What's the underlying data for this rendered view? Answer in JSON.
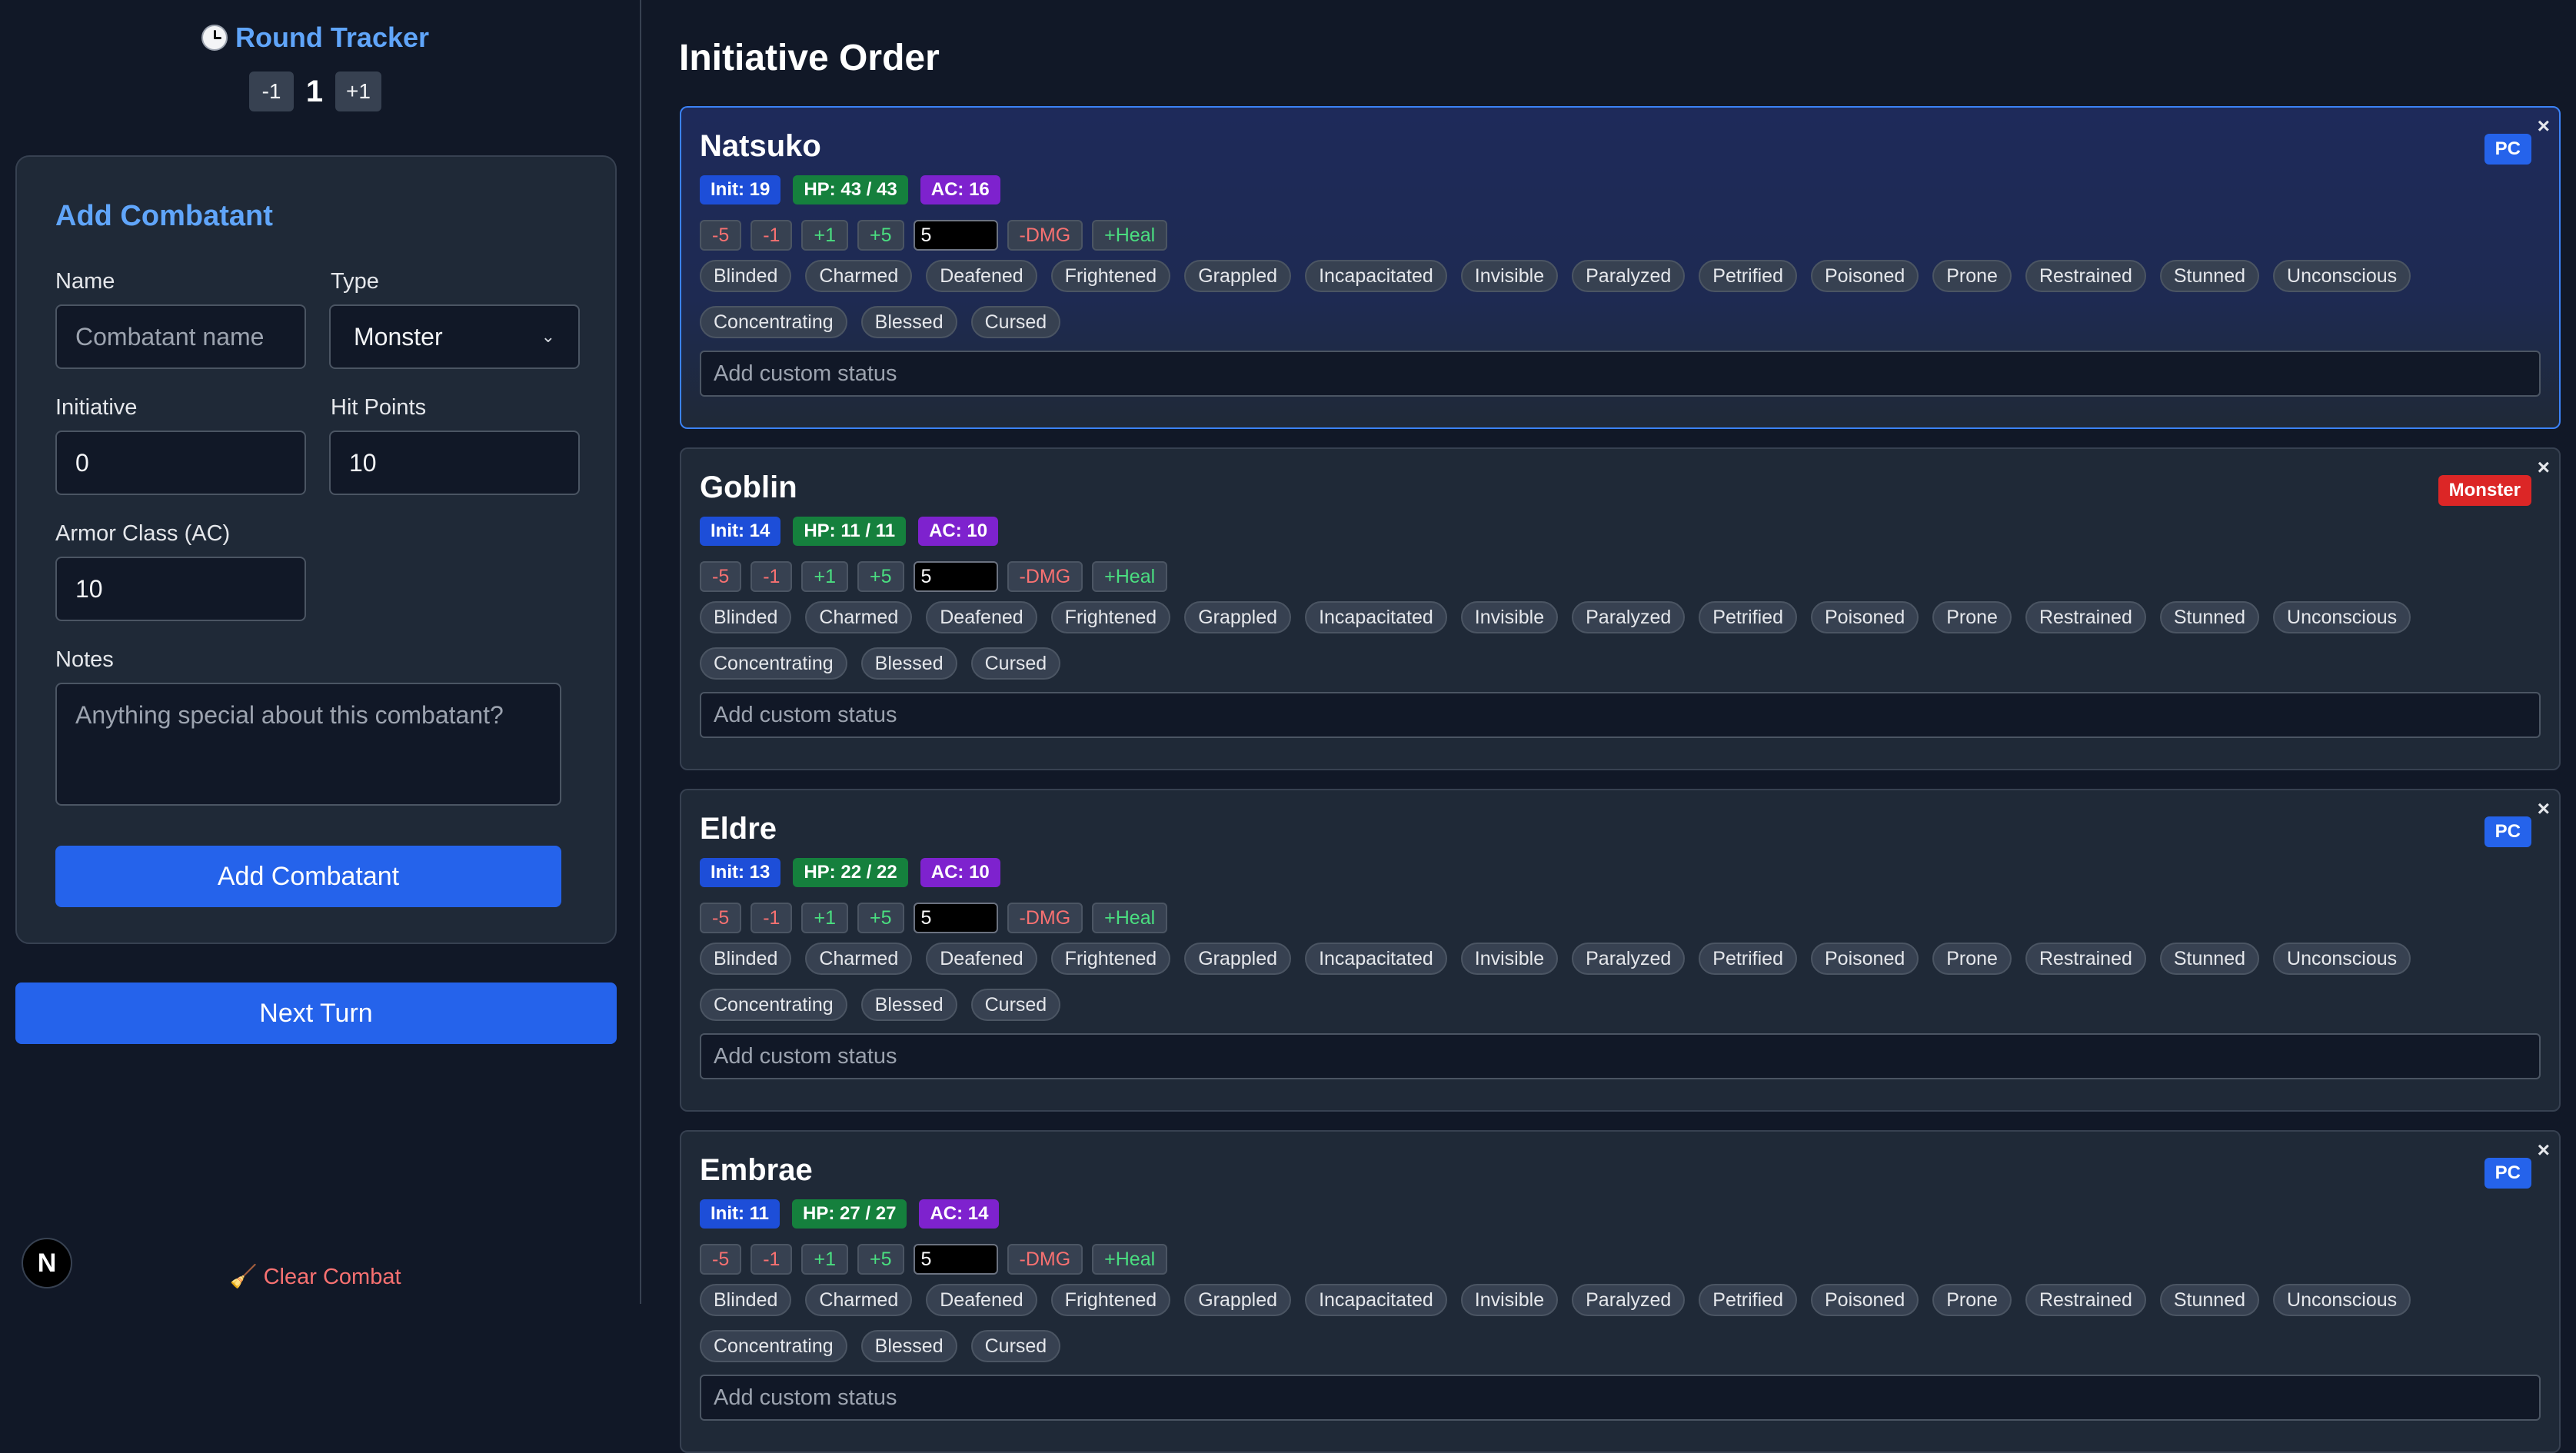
{
  "round_tracker": {
    "title": "Round Tracker",
    "clock_icon": "clock-icon",
    "dec_label": "-1",
    "round": "1",
    "inc_label": "+1"
  },
  "add_form": {
    "title": "Add Combatant",
    "name_label": "Name",
    "name_placeholder": "Combatant name",
    "type_label": "Type",
    "type_value": "Monster",
    "initiative_label": "Initiative",
    "initiative_value": "0",
    "hp_label": "Hit Points",
    "hp_value": "10",
    "ac_label": "Armor Class (AC)",
    "ac_value": "10",
    "notes_label": "Notes",
    "notes_placeholder": "Anything special about this combatant?",
    "submit_label": "Add Combatant"
  },
  "next_turn_label": "Next Turn",
  "clear_combat_label": "🧹 Clear Combat",
  "next_badge": "N",
  "main_title": "Initiative Order",
  "hp_controls": {
    "minus5": "-5",
    "minus1": "-1",
    "plus1": "+1",
    "plus5": "+5",
    "amount": "5",
    "dmg": "-DMG",
    "heal": "+Heal"
  },
  "conditions_row1": [
    "Blinded",
    "Charmed",
    "Deafened",
    "Frightened",
    "Grappled",
    "Incapacitated",
    "Invisible",
    "Paralyzed",
    "Petrified",
    "Poisoned",
    "Prone",
    "Restrained",
    "Stunned",
    "Unconscious"
  ],
  "conditions_row2": [
    "Concentrating",
    "Blessed",
    "Cursed"
  ],
  "custom_status_placeholder": "Add custom status",
  "close_symbol": "×",
  "combatants": [
    {
      "name": "Natsuko",
      "type": "PC",
      "init": "Init: 19",
      "hp": "HP: 43 / 43",
      "ac": "AC: 16",
      "active": true
    },
    {
      "name": "Goblin",
      "type": "Monster",
      "init": "Init: 14",
      "hp": "HP: 11 / 11",
      "ac": "AC: 10",
      "active": false
    },
    {
      "name": "Eldre",
      "type": "PC",
      "init": "Init: 13",
      "hp": "HP: 22 / 22",
      "ac": "AC: 10",
      "active": false
    },
    {
      "name": "Embrae",
      "type": "PC",
      "init": "Init: 11",
      "hp": "HP: 27 / 27",
      "ac": "AC: 14",
      "active": false
    }
  ],
  "colors": {
    "accent": "#2563eb",
    "title_blue": "#60a5fa",
    "danger": "#dc2626",
    "init_badge": "#1d4ed8",
    "hp_badge": "#15803d",
    "ac_badge": "#7e22ce"
  }
}
